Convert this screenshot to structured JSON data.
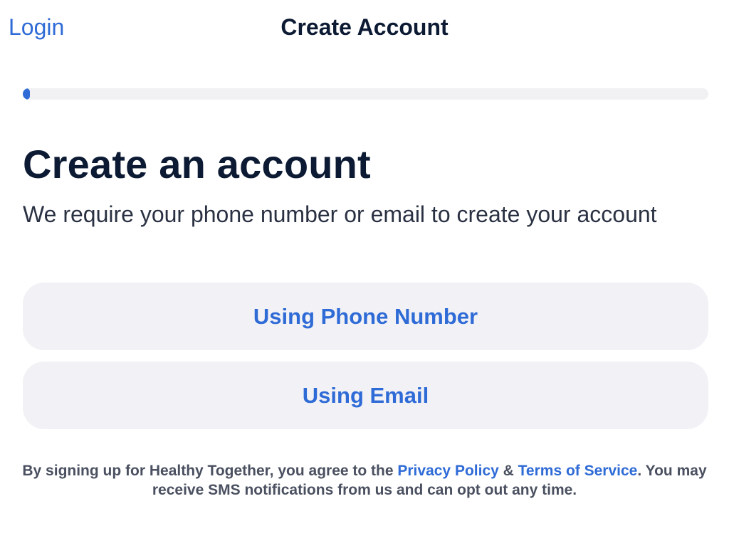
{
  "nav": {
    "login_label": "Login",
    "title": "Create Account"
  },
  "progress": {
    "fraction": 0.01,
    "color": "#2f6bd6"
  },
  "main": {
    "heading": "Create an account",
    "subtitle": "We require your phone number or email to create your account"
  },
  "options": {
    "phone_label": "Using Phone Number",
    "email_label": "Using Email"
  },
  "legal": {
    "prefix": "By signing up for Healthy Together, you agree to the ",
    "privacy_link": "Privacy Policy",
    "ampersand": " & ",
    "terms_link": "Terms of Service",
    "suffix": ". You may receive SMS notifications from us and can opt out any time."
  },
  "colors": {
    "accent": "#2f6bd6",
    "heading": "#0c1a33",
    "button_bg": "#f2f2f6"
  }
}
